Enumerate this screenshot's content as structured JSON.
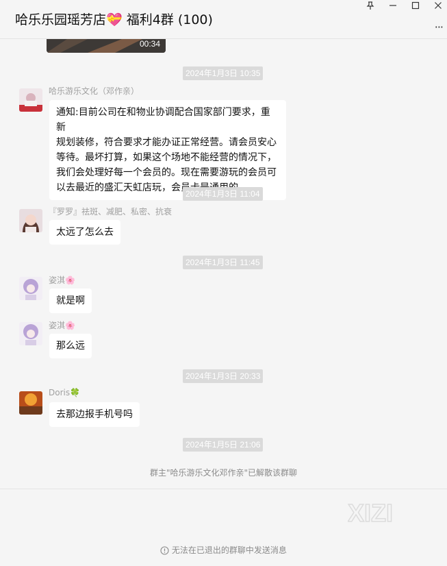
{
  "window": {
    "title": "哈乐乐园瑶芳店💝 福利4群 (100)",
    "controls": [
      "pin-icon",
      "minimize-icon",
      "maximize-icon",
      "close-icon"
    ],
    "more_label": "···"
  },
  "video": {
    "duration": "00:34"
  },
  "timestamps": [
    "2024年1月3日 10:35",
    "2024年1月3日 11:04",
    "2024年1月3日 11:45",
    "2024年1月3日 20:33",
    "2024年1月5日 21:06"
  ],
  "messages": [
    {
      "sender": "哈乐游乐文化（邓作亲）",
      "lines": [
        "通知:目前公司在和物业协调配合国家部门要求，重新",
        "规划装修，符合要求才能办证正常经营。请会员安心",
        "等待。最坏打算，如果这个场地不能经营的情况下，",
        "我们会处理好每一个会员的。现在需要游玩的会员可",
        "以去最近的盛汇天虹店玩，会员卡是通用的。"
      ]
    },
    {
      "sender": "『罗罗』祛斑、减肥、私密、抗衰",
      "text": "太远了怎么去"
    },
    {
      "sender": "姿淇🌸",
      "text": "就是啊"
    },
    {
      "sender": "姿淇🌸",
      "text": "那么远"
    },
    {
      "sender": "Doris🍀",
      "text": "去那边报手机号吗"
    }
  ],
  "system_message": "群主\"哈乐游乐文化邓作亲\"已解散该群聊",
  "footer": {
    "notice": "无法在已退出的群聊中发送消息",
    "watermark": "XIZI"
  },
  "colors": {
    "background": "#f5f5f5",
    "bubble": "#ffffff",
    "timestamp_bg": "#dadada",
    "meta_text": "#a0a0a0"
  }
}
